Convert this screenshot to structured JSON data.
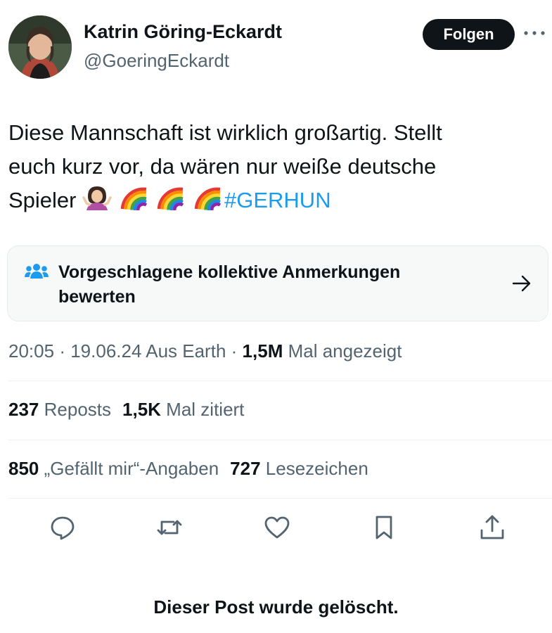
{
  "author": {
    "name": "Katrin Göring-Eckardt",
    "handle": "@GoeringEckardt"
  },
  "header": {
    "follow_label": "Folgen",
    "more_icon": "more-horizontal-icon"
  },
  "tweet": {
    "line1": "Diese Mannschaft ist wirklich großartig. Stellt",
    "line2": "euch kurz vor, da wären nur weiße deutsche",
    "line3": "Spieler",
    "emojis": [
      "person-shrugging-emoji",
      "rainbow-emoji",
      "rainbow-emoji",
      "rainbow-emoji"
    ],
    "hashtag": "#GERHUN"
  },
  "community_notes": {
    "icon": "people-icon",
    "label": "Vorgeschlagene kollektive Anmerkungen bewerten",
    "arrow_icon": "arrow-right-icon"
  },
  "meta": {
    "time": "20:05",
    "separator": "·",
    "date": "19.06.24",
    "source": "Aus Earth",
    "views": "1,5M",
    "views_label": "Mal angezeigt"
  },
  "stats": {
    "reposts": "237",
    "reposts_label": "Reposts",
    "quotes": "1,5K",
    "quotes_label": "Mal zitiert",
    "likes": "850",
    "likes_label": "„Gefällt mir“-Angaben",
    "bookmarks": "727",
    "bookmarks_label": "Lesezeichen"
  },
  "actions": [
    "reply-icon",
    "repost-icon",
    "like-icon",
    "bookmark-icon",
    "share-icon"
  ],
  "deleted_message": "Dieser Post wurde gelöscht.",
  "colors": {
    "text": "#0f1419",
    "secondary": "#536471",
    "link": "#1d9bf0",
    "button_bg": "#0f1419",
    "card_bg": "#f7f9f9"
  }
}
